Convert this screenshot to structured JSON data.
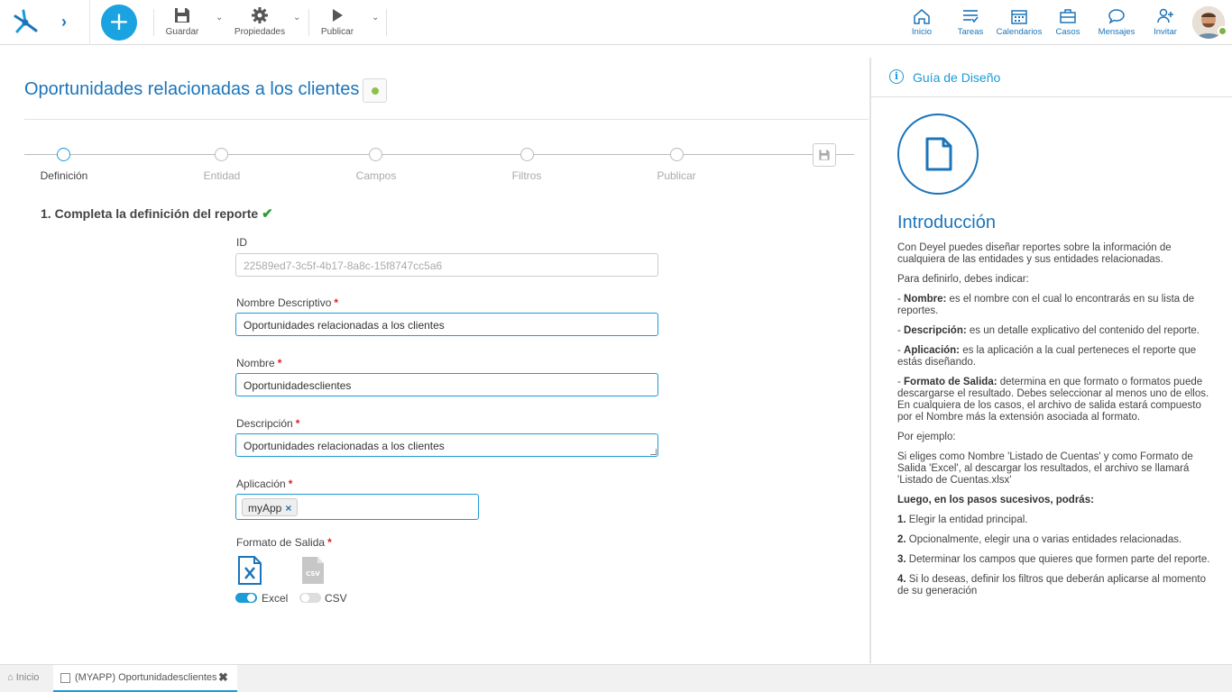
{
  "toolbar": {
    "save": "Guardar",
    "properties": "Propiedades",
    "publish": "Publicar"
  },
  "nav": [
    {
      "label": "Inicio",
      "icon": "home-icon"
    },
    {
      "label": "Tareas",
      "icon": "tasks-icon"
    },
    {
      "label": "Calendarios",
      "icon": "calendar-icon"
    },
    {
      "label": "Casos",
      "icon": "briefcase-icon"
    },
    {
      "label": "Mensajes",
      "icon": "chat-icon"
    },
    {
      "label": "Invitar",
      "icon": "invite-icon"
    }
  ],
  "page": {
    "title": "Oportunidades relacionadas a los clientes",
    "status_color": "#8bc34a"
  },
  "steps": [
    {
      "label": "Definición",
      "active": true
    },
    {
      "label": "Entidad",
      "active": false
    },
    {
      "label": "Campos",
      "active": false
    },
    {
      "label": "Filtros",
      "active": false
    },
    {
      "label": "Publicar",
      "active": false
    }
  ],
  "form": {
    "section_title": "1. Completa la definición del reporte",
    "id_label": "ID",
    "id_value": "22589ed7-3c5f-4b17-8a8c-15f8747cc5a6",
    "nombre_descriptivo_label": "Nombre Descriptivo",
    "nombre_descriptivo_value": "Oportunidades relacionadas a los clientes",
    "nombre_label": "Nombre",
    "nombre_value": "Oportunidadesclientes",
    "descripcion_label": "Descripción",
    "descripcion_value": "Oportunidades relacionadas a los clientes",
    "aplicacion_label": "Aplicación",
    "aplicacion_tag": "myApp",
    "formato_label": "Formato de Salida",
    "excel_label": "Excel",
    "excel_on": true,
    "csv_label": "CSV",
    "csv_on": false,
    "required_mark": "*"
  },
  "guide": {
    "header": "Guía de Diseño",
    "intro_title": "Introducción",
    "p1": "Con Deyel puedes diseñar reportes sobre la información de cualquiera de las entidades y sus entidades relacionadas.",
    "p2": "Para definirlo, debes indicar:",
    "nombre_b": "Nombre:",
    "nombre_t": " es el nombre con el cual lo encontrarás en su lista de reportes.",
    "desc_b": "Descripción:",
    "desc_t": " es un detalle explicativo del contenido del reporte.",
    "app_b": "Aplicación:",
    "app_t": " es la aplicación a la cual perteneces el reporte que estás diseñando.",
    "fmt_b": "Formato de Salida:",
    "fmt_t": " determina en que formato o formatos puede descargarse el resultado. Debes seleccionar al menos uno de ellos. En cualquiera de los casos, el archivo de salida estará compuesto por el Nombre más la extensión asociada al formato.",
    "p_ej": "Por ejemplo:",
    "p_si": "Si eliges como Nombre 'Listado de Cuentas' y como Formato de Salida 'Excel', al descargar los resultados, el archivo se llamará 'Listado de Cuentas.xlsx'",
    "luego": "Luego, en los pasos sucesivos, podrás:",
    "s1n": "1.",
    "s1": " Elegir la entidad principal.",
    "s2n": "2.",
    "s2": " Opcionalmente, elegir una o varias entidades relacionadas.",
    "s3n": "3.",
    "s3": " Determinar los campos que quieres que formen parte del reporte.",
    "s4n": "4.",
    "s4": " Si lo deseas, definir los filtros que deberán aplicarse al momento de su generación",
    "dash": "- "
  },
  "bottom_tabs": {
    "home": "Inicio",
    "active": "(MYAPP) Oportunidadesclientes"
  }
}
